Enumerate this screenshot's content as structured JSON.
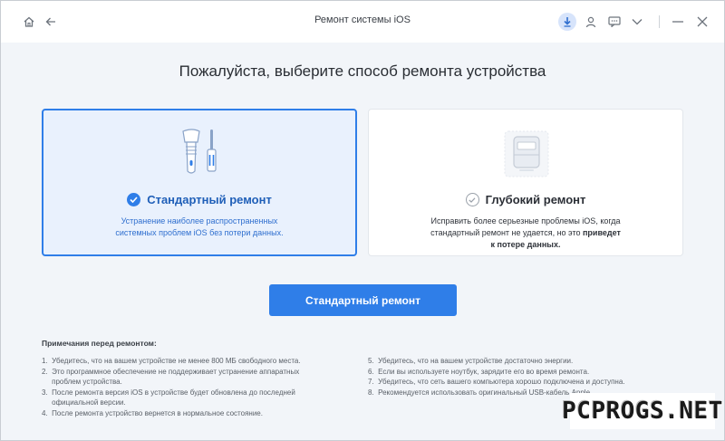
{
  "window": {
    "title": "Ремонт системы iOS"
  },
  "titlebar_icons": [
    "home-icon",
    "back-arrow-icon",
    "download-icon",
    "user-icon",
    "feedback-icon",
    "chevron-down-icon",
    "minimize-icon",
    "close-icon"
  ],
  "heading": "Пожалуйста, выберите способ ремонта устройства",
  "cards": {
    "standard": {
      "title": "Стандартный ремонт",
      "desc_line1": "Устранение наиболее распространенных",
      "desc_line2": "системных проблем iOS без потери данных.",
      "selected": true
    },
    "deep": {
      "title": "Глубокий ремонт",
      "desc_line1": "Исправить более серьезные проблемы iOS, когда",
      "desc_line2_a": "стандартный ремонт не удается, но это ",
      "desc_line2_b": "приведет",
      "desc_line3": "к потере данных.",
      "selected": false
    }
  },
  "cta_label": "Стандартный ремонт",
  "notes": {
    "title": "Примечания перед ремонтом:",
    "left": [
      "1.  Убедитесь, что на вашем устройстве не менее 800 МБ свободного места.",
      "2.  Это программное обеспечение не поддерживает устранение аппаратных",
      "     проблем устройства.",
      "3.  После ремонта версия iOS в устройстве будет обновлена до последней",
      "     официальной версии.",
      "4.  После ремонта устройство вернется в нормальное состояние."
    ],
    "right": [
      "5.  Убедитесь, что на вашем устройстве достаточно энергии.",
      "6.  Если вы используете ноутбук, зарядите его во время ремонта.",
      "7.  Убедитесь, что сеть вашего компьютера хорошо подключена и доступна.",
      "8.  Рекомендуется использовать оригинальный USB-кабель Apple."
    ]
  },
  "watermark": "PCPROGS.NET",
  "colors": {
    "accent": "#2f7ee8",
    "selected_card_bg": "#e9f1fd",
    "background": "#f2f5f9"
  }
}
